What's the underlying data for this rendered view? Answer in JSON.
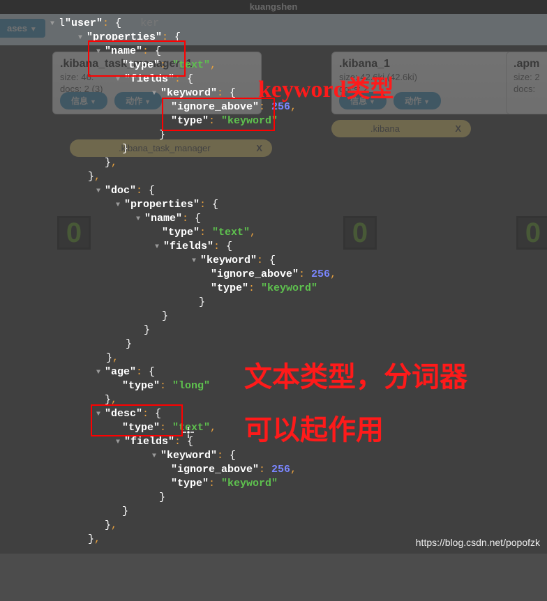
{
  "title": "kuangshen",
  "toolbar": {
    "dropdown": "ases"
  },
  "cards": [
    {
      "title": ".kibana_task_manager_1",
      "size": "size: 46.",
      "docs": "docs: 2 (3)",
      "info": "信息",
      "act": "动作"
    },
    {
      "title": ".kibana_1",
      "size": "size: 42.6ki (42.6ki)",
      "docs": "docs: 2",
      "info": "信息",
      "act": "动作"
    },
    {
      "title": ".apm",
      "size": "size: 2",
      "docs": "docs: ",
      "info": "信息",
      "act": "动作"
    }
  ],
  "tags": [
    {
      "name": ".kibana_task_manager",
      "x": "X"
    },
    {
      "name": ".kibana",
      "x": "X"
    }
  ],
  "zeros": [
    "0",
    "0",
    "0"
  ],
  "annotations": {
    "a1": "keyword类型",
    "a2": "文本类型，分词器",
    "a3": "可以起作用"
  },
  "code": {
    "user": "\"user\"",
    "props": "\"properties\"",
    "name": "\"name\"",
    "type": "\"type\"",
    "fields": "\"fields\"",
    "keyword": "\"keyword\"",
    "ign": "\"ignore_above\"",
    "doc": "\"doc\"",
    "age": "\"age\"",
    "desc": "\"desc\"",
    "textv": "\"text\"",
    "kwv": "\"keyword\"",
    "longv": "\"long\"",
    "n256": "256",
    "ker": "ker"
  },
  "watermark": "https://blog.csdn.net/popofzk"
}
